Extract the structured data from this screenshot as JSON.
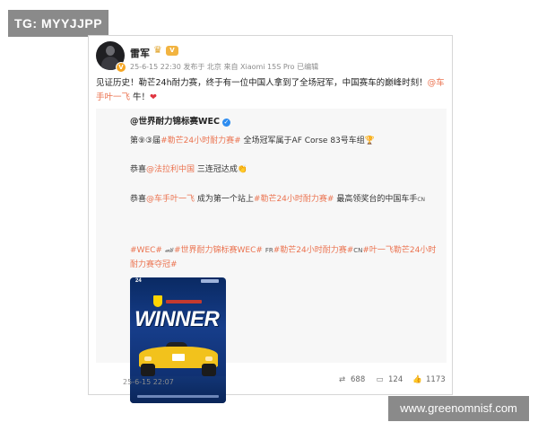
{
  "overlay": {
    "tg_tag": "TG: MYYJJPP",
    "watermark": "www.greenomnisf.com"
  },
  "post": {
    "username": "雷军",
    "vip_label": "V",
    "meta": "25-6-15 22:30 发布于 北京 来自 Xiaomi 15S Pro 已编辑",
    "text_before_link": "见证历史！勒芒24h耐力赛，终于有一位中国人拿到了全场冠军，中国赛车的巅峰时刻！",
    "mention": "@车手叶一飞",
    "text_after_link": " 牛！",
    "heart": "❤"
  },
  "quoted": {
    "author": "@世界耐力锦标赛WEC",
    "line1_prefix": "第⑨③届",
    "line1_tag": "#勒芒24小时耐力赛#",
    "line1_suffix": " 全场冠军属于AF Corse 83号车组🏆",
    "line2_prefix": "恭喜",
    "line2_mention": "@法拉利中国",
    "line2_suffix": " 三连冠达成👏",
    "line3_prefix": "恭喜",
    "line3_mention": "@车手叶一飞",
    "line3_mid": " 成为第一个站上",
    "line3_tag": "#勒芒24小时耐力赛#",
    "line3_suffix": " 最高领奖台的中国车手",
    "line3_flag": "CN",
    "tags": {
      "t1": "#WEC#",
      "car": "🏎",
      "t2": "#世界耐力锦标赛WEC#",
      "fr": "FR",
      "t3": "#勒芒24小时耐力赛#",
      "cn": "CN",
      "t4": "#叶一飞勒芒24小时耐力赛夺冠#"
    },
    "poster": {
      "logo": "24",
      "headline": "WINNER"
    }
  },
  "footer": {
    "time": "25-6-15 22:07",
    "reposts": "688",
    "comments": "124",
    "likes": "1173"
  },
  "icons": {
    "repost": "repost-icon",
    "comment": "comment-icon",
    "like": "like-icon",
    "crown": "crown-icon",
    "heart": "heart-icon"
  },
  "colors": {
    "link": "#eb7350",
    "verified_blue": "#2d8cf0",
    "gray_overlay": "#8a8a8a"
  }
}
